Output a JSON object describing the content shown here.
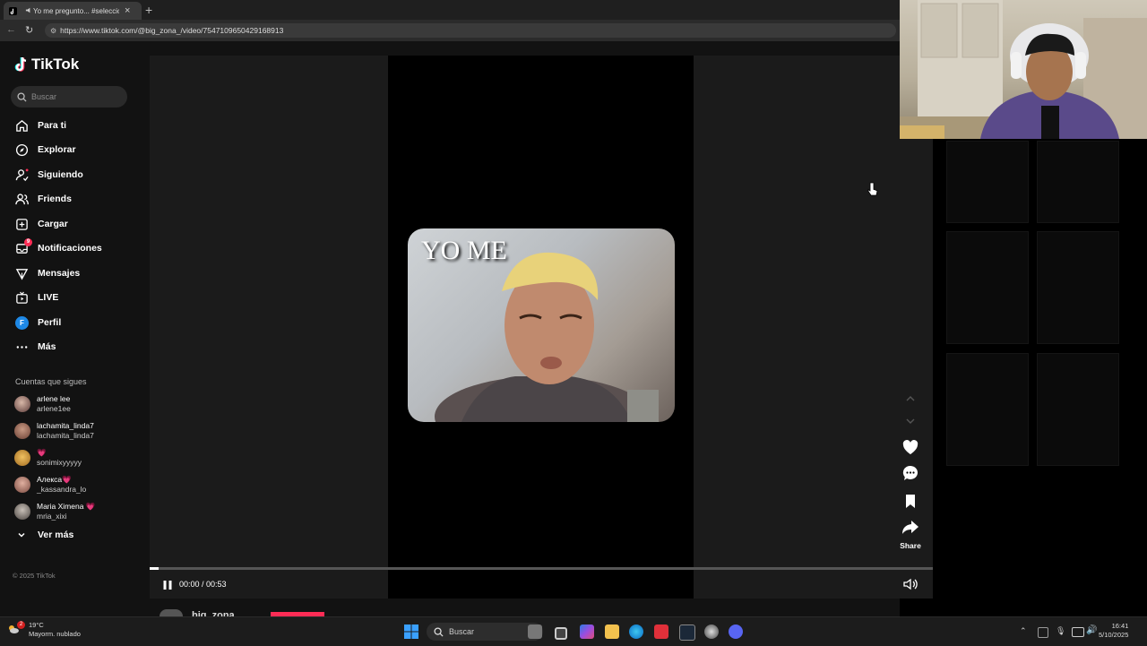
{
  "browser": {
    "tab_title": "Yo me pregunto... #seleccion",
    "url": "https://www.tiktok.com/@big_zona_/video/7547109650429168913"
  },
  "sidebar": {
    "logo": "TikTok",
    "search_placeholder": "Buscar",
    "nav": [
      {
        "label": "Para ti",
        "icon": "home-icon"
      },
      {
        "label": "Explorar",
        "icon": "compass-icon"
      },
      {
        "label": "Siguiendo",
        "icon": "following-icon"
      },
      {
        "label": "Friends",
        "icon": "friends-icon"
      },
      {
        "label": "Cargar",
        "icon": "upload-icon"
      },
      {
        "label": "Notificaciones",
        "icon": "inbox-icon"
      },
      {
        "label": "Mensajes",
        "icon": "send-icon"
      },
      {
        "label": "LIVE",
        "icon": "live-icon"
      },
      {
        "label": "Perfil",
        "icon": "profile-avatar-icon"
      },
      {
        "label": "Más",
        "icon": "more-icon"
      }
    ],
    "notification_badge": "9",
    "profile_initial": "F",
    "following_header": "Cuentas que sigues",
    "accounts": [
      {
        "name": "arlene lee",
        "handle": "arlene1ee"
      },
      {
        "name": "lachamita_linda7",
        "handle": "lachamita_linda7"
      },
      {
        "name": "💗",
        "handle": "sonimixyyyyy"
      },
      {
        "name": "Алекса💗",
        "handle": "_kassandra_lo"
      },
      {
        "name": "Maria Ximena 💗",
        "handle": "mria_xixi"
      }
    ],
    "see_more": "Ver más",
    "copyright": "© 2025 TikTok"
  },
  "player": {
    "caption": "YO ME",
    "time": "00:00 / 00:53",
    "progress_fraction": 0.012,
    "share_label": "Share",
    "author": "big_zona"
  },
  "taskbar": {
    "weather_temp": "19°C",
    "weather_desc": "Mayorm. nublado",
    "weather_badge": "2",
    "search_label": "Buscar",
    "time": "16:41",
    "date": "5/10/2025"
  },
  "colors": {
    "accent": "#fe2c55",
    "profile": "#1e88e5"
  }
}
